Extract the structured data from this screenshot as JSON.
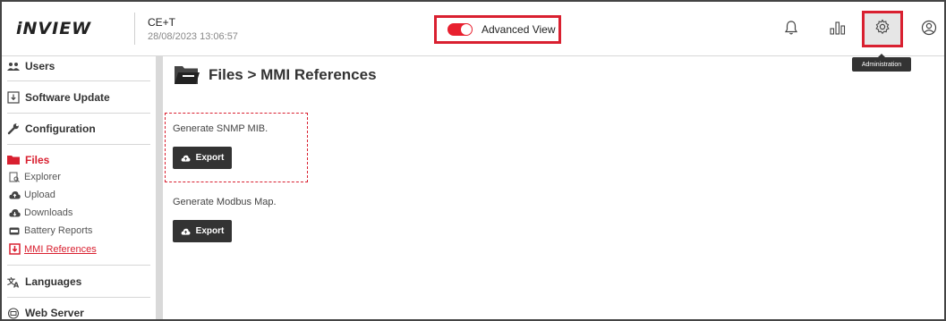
{
  "header": {
    "logo": "iNVIEW",
    "timezone": "CE+T",
    "datetime": "28/08/2023 13:06:57",
    "advanced_view_label": "Advanced View",
    "advanced_view_on": true,
    "admin_tooltip": "Administration",
    "icons": [
      "bell-icon",
      "bar-chart-icon",
      "gear-icon",
      "user-icon"
    ]
  },
  "sidebar": {
    "users": "Users",
    "software_update": "Software Update",
    "configuration": "Configuration",
    "files": "Files",
    "files_items": [
      "Explorer",
      "Upload",
      "Downloads",
      "Battery Reports",
      "MMI References"
    ],
    "languages": "Languages",
    "web_server": "Web Server"
  },
  "main": {
    "title": "Files > MMI References",
    "snmp_label": "Generate SNMP MIB.",
    "modbus_label": "Generate Modbus Map.",
    "export_label": "Export"
  },
  "colors": {
    "accent": "#d92030",
    "button": "#333333"
  }
}
